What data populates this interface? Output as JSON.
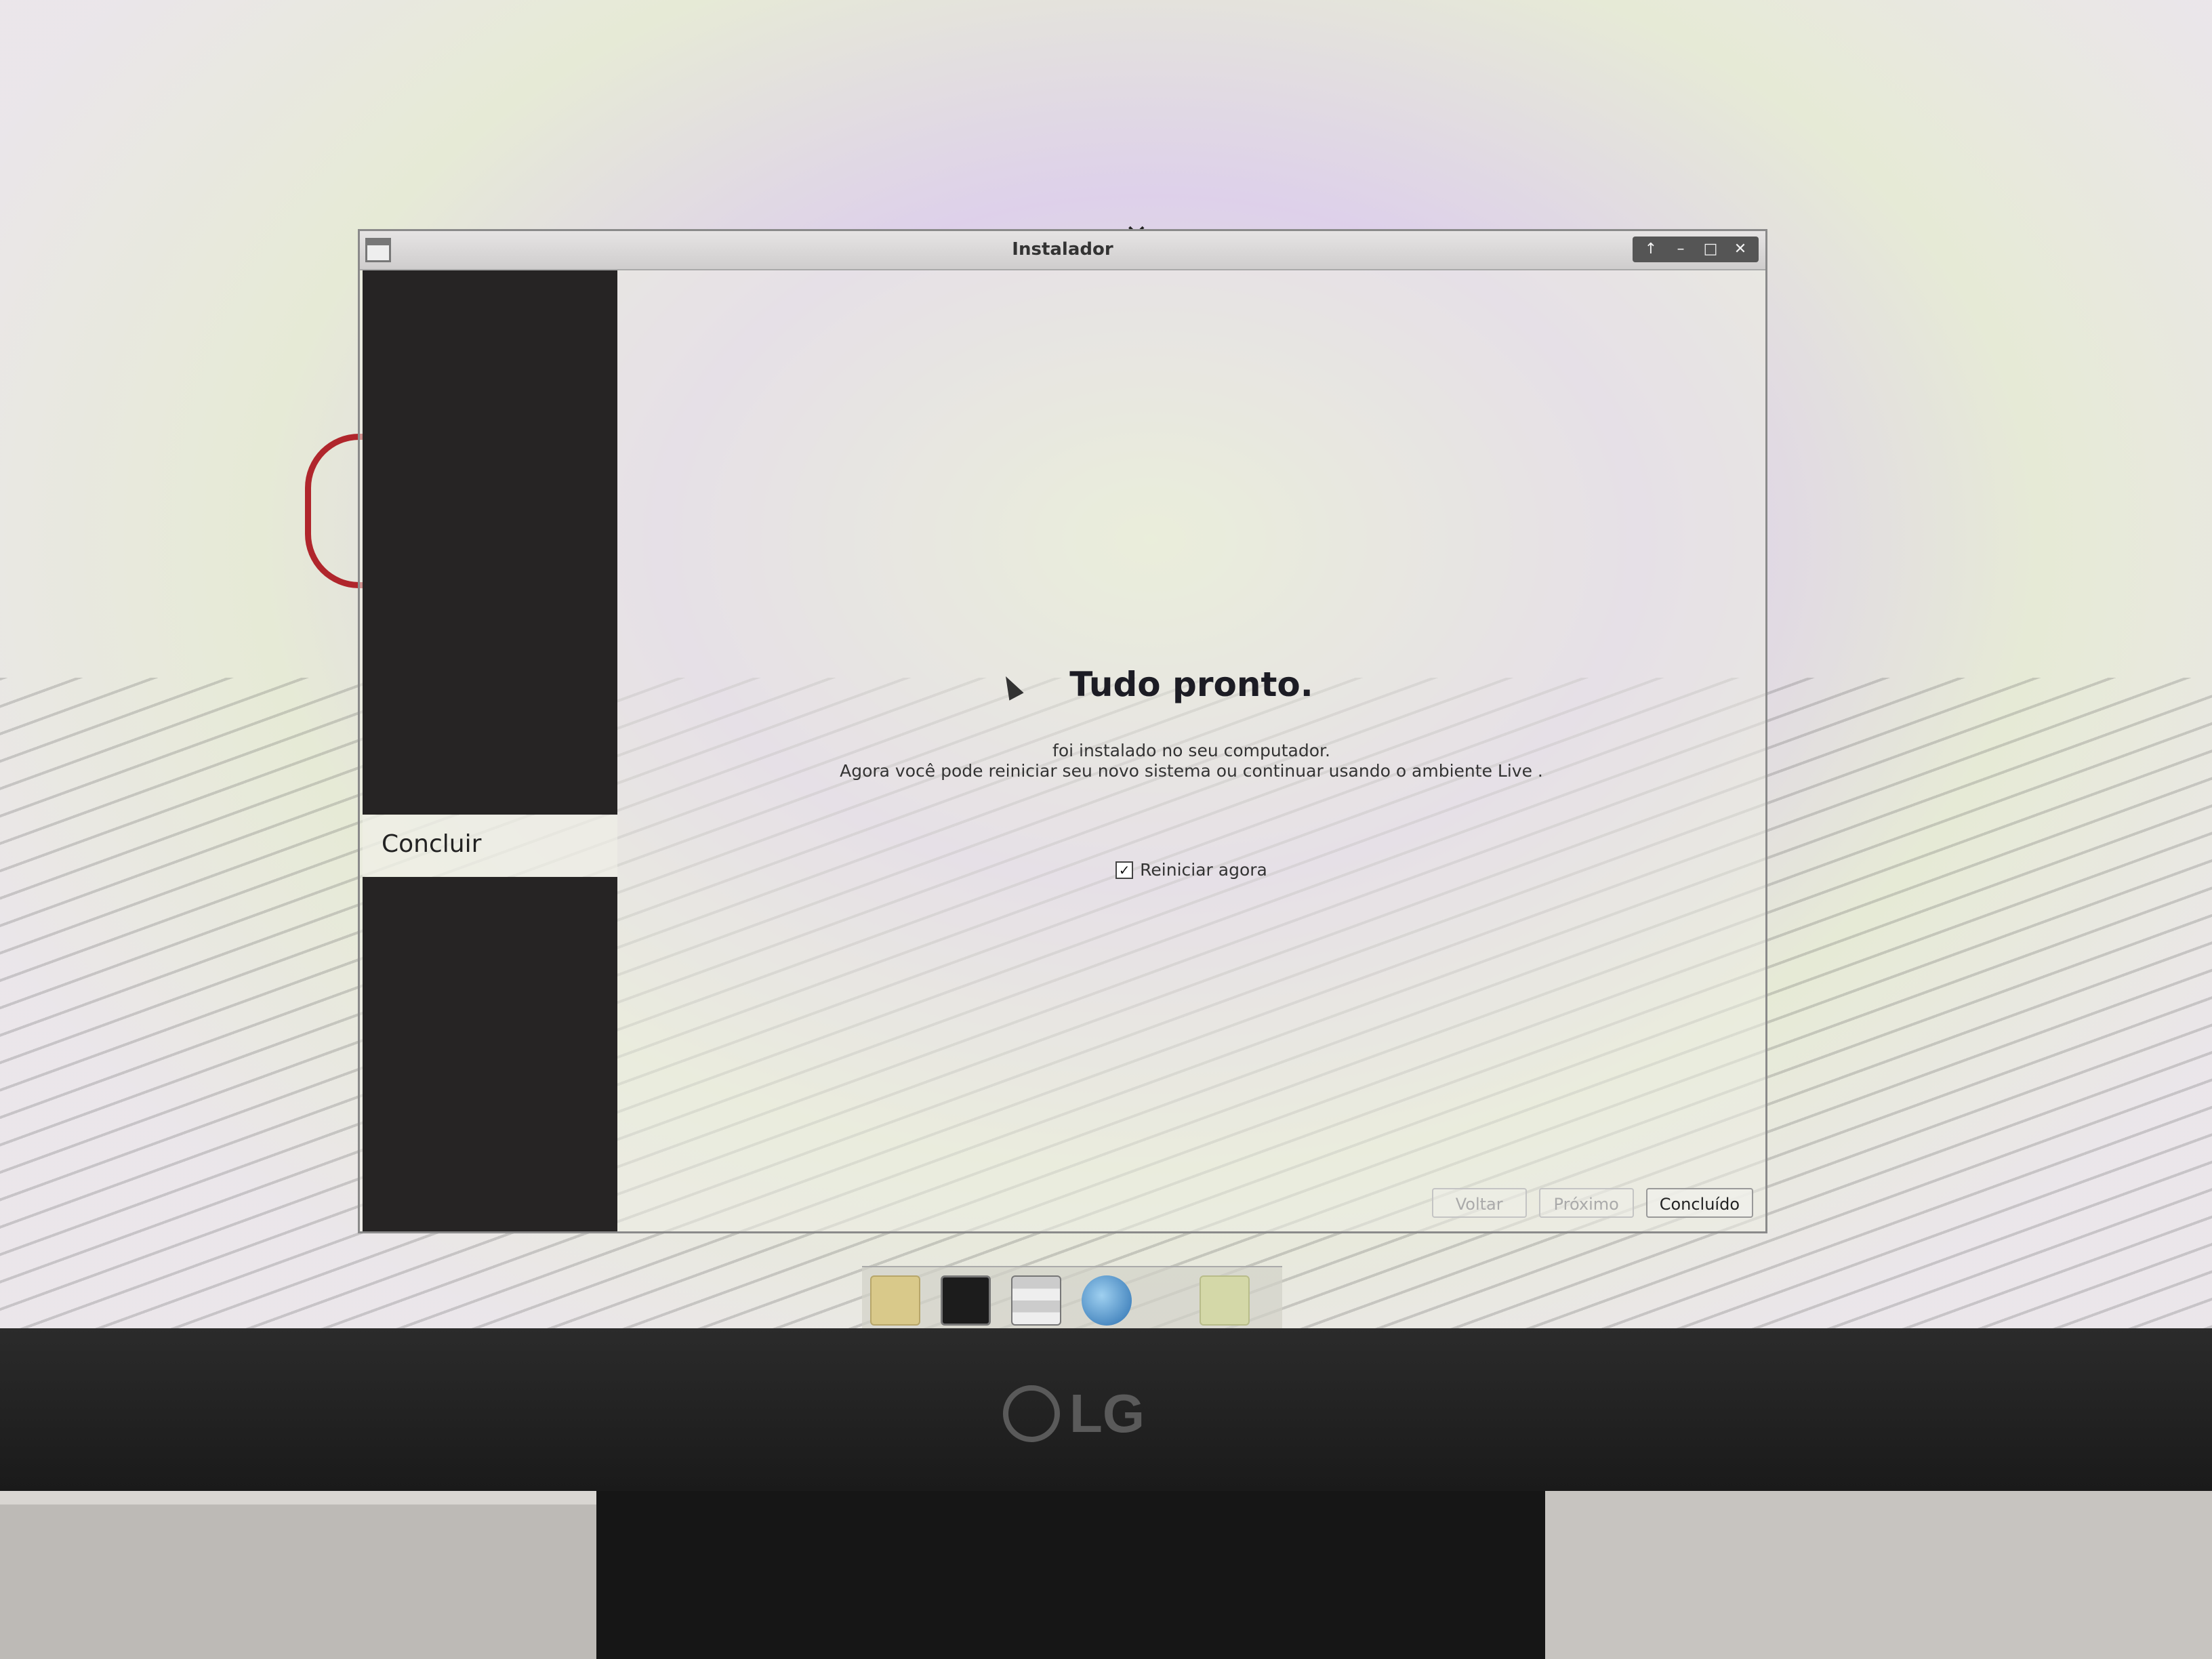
{
  "window": {
    "title": "Instalador"
  },
  "window_controls": {
    "up": "↑",
    "minimize": "–",
    "maximize": "□",
    "close": "✕"
  },
  "sidebar": {
    "current_step": "Concluir"
  },
  "main": {
    "heading": "Tudo pronto.",
    "message_line1": "foi instalado no seu computador.",
    "message_line2": "Agora você pode reiniciar seu novo sistema ou continuar usando o ambiente Live .",
    "restart_checkbox_label": "Reiniciar agora",
    "restart_checked": true,
    "check_mark": "✓"
  },
  "buttons": {
    "back": "Voltar",
    "next": "Próximo",
    "done": "Concluído"
  },
  "monitor": {
    "brand": "LG"
  },
  "dock": {
    "icons": [
      "folder-icon",
      "terminal-icon",
      "file-manager-icon",
      "browser-icon",
      "folder-icon"
    ]
  }
}
